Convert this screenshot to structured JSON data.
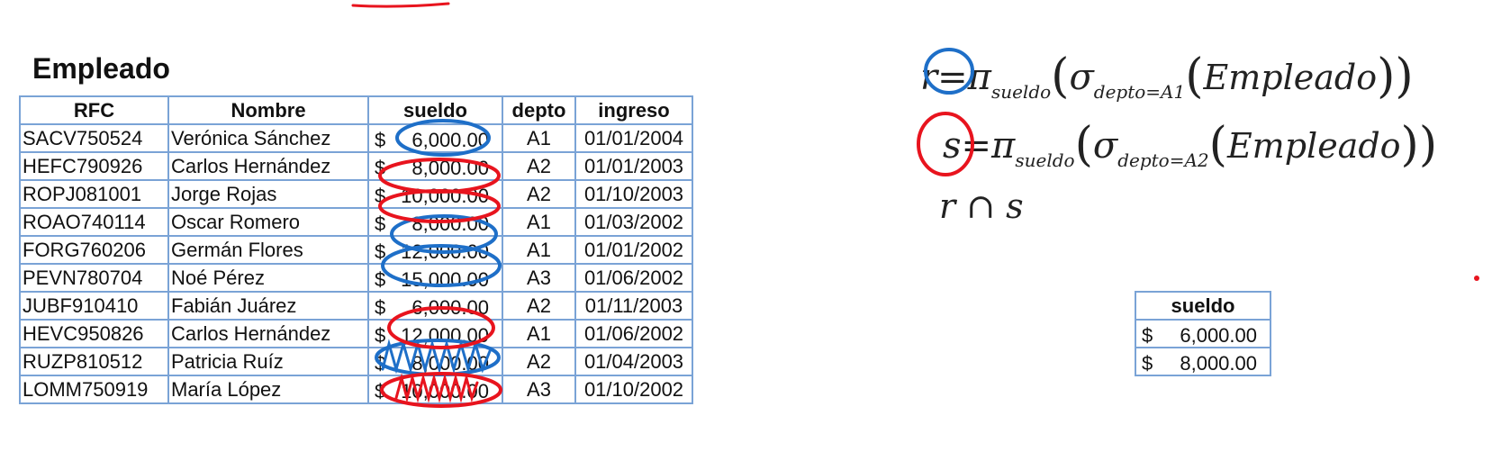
{
  "title": "Empleado",
  "employee_table": {
    "headers": [
      "RFC",
      "Nombre",
      "sueldo",
      "depto",
      "ingreso"
    ],
    "rows": [
      {
        "rfc": "SACV750524",
        "nombre": "Verónica Sánchez",
        "cur": "$",
        "sueldo": "6,000.00",
        "depto": "A1",
        "ingreso": "01/01/2004"
      },
      {
        "rfc": "HEFC790926",
        "nombre": "Carlos Hernández",
        "cur": "$",
        "sueldo": "8,000.00",
        "depto": "A2",
        "ingreso": "01/01/2003"
      },
      {
        "rfc": "ROPJ081001",
        "nombre": "Jorge Rojas",
        "cur": "$",
        "sueldo": "10,000.00",
        "depto": "A2",
        "ingreso": "01/10/2003"
      },
      {
        "rfc": "ROAO740114",
        "nombre": "Oscar Romero",
        "cur": "$",
        "sueldo": "8,000.00",
        "depto": "A1",
        "ingreso": "01/03/2002"
      },
      {
        "rfc": "FORG760206",
        "nombre": "Germán Flores",
        "cur": "$",
        "sueldo": "12,000.00",
        "depto": "A1",
        "ingreso": "01/01/2002"
      },
      {
        "rfc": "PEVN780704",
        "nombre": "Noé Pérez",
        "cur": "$",
        "sueldo": "15,000.00",
        "depto": "A3",
        "ingreso": "01/06/2002"
      },
      {
        "rfc": "JUBF910410",
        "nombre": "Fabián Juárez",
        "cur": "$",
        "sueldo": "6,000.00",
        "depto": "A2",
        "ingreso": "01/11/2003"
      },
      {
        "rfc": "HEVC950826",
        "nombre": "Carlos Hernández",
        "cur": "$",
        "sueldo": "12,000.00",
        "depto": "A1",
        "ingreso": "01/06/2002"
      },
      {
        "rfc": "RUZP810512",
        "nombre": "Patricia Ruíz",
        "cur": "$",
        "sueldo": "8,000.00",
        "depto": "A2",
        "ingreso": "01/04/2003"
      },
      {
        "rfc": "LOMM750919",
        "nombre": "María López",
        "cur": "$",
        "sueldo": "10,000.00",
        "depto": "A3",
        "ingreso": "01/10/2002"
      }
    ]
  },
  "expressions": {
    "r": {
      "var": "r",
      "eq": "=",
      "pi": "π",
      "proj": "sueldo",
      "sigma": "σ",
      "cond": "depto=A1",
      "rel": "Empleado"
    },
    "s": {
      "var": "s",
      "eq": "=",
      "pi": "π",
      "proj": "sueldo",
      "sigma": "σ",
      "cond": "depto=A2",
      "rel": "Empleado"
    },
    "intersection": "r ∩ s"
  },
  "result_table": {
    "header": "sueldo",
    "rows": [
      {
        "cur": "$",
        "sueldo": "6,000.00"
      },
      {
        "cur": "$",
        "sueldo": "8,000.00"
      }
    ]
  },
  "colors": {
    "blue_marker": "#1e6fc8",
    "red_marker": "#e8141e",
    "table_border": "#7aa3d6"
  }
}
